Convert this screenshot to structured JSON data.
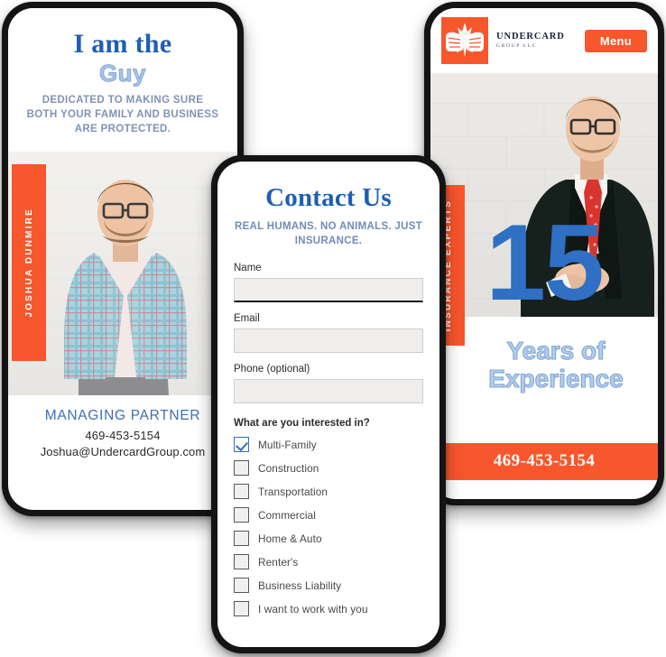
{
  "brand": {
    "accent_orange": "#f8562c",
    "primary_blue": "#1f5fb4",
    "light_blue": "#a7c4e8",
    "muted_blue": "#7f93b5",
    "company_name_line1": "UNDERCARD",
    "company_name_line2": "GROUP LLC",
    "logo_icon": "fist-bump-logo-icon"
  },
  "left_phone": {
    "headline": "I am the",
    "headline_accent": "Guy",
    "subheadline": "DEDICATED TO MAKING SURE BOTH YOUR FAMILY AND BUSINESS ARE PROTECTED.",
    "vertical_tab": "JOSHUA DUNMIRE",
    "photo_alt": "man-in-light-blue-plaid-blazer-photo",
    "role": "MANAGING PARTNER",
    "phone": "469-453-5154",
    "email": "Joshua@UndercardGroup.com"
  },
  "center_phone": {
    "title": "Contact Us",
    "subtitle": "REAL HUMANS. NO ANIMALS. JUST INSURANCE.",
    "fields": [
      {
        "label": "Name",
        "value": "",
        "placeholder": "",
        "focused": true
      },
      {
        "label": "Email",
        "value": "",
        "placeholder": "",
        "focused": false
      },
      {
        "label": "Phone (optional)",
        "value": "",
        "placeholder": "",
        "focused": false
      }
    ],
    "question": "What are you interested in?",
    "options": [
      {
        "label": "Multi-Family",
        "checked": true
      },
      {
        "label": "Construction",
        "checked": false
      },
      {
        "label": "Transportation",
        "checked": false
      },
      {
        "label": "Commercial",
        "checked": false
      },
      {
        "label": "Home & Auto",
        "checked": false
      },
      {
        "label": "Renter's",
        "checked": false
      },
      {
        "label": "Business Liability",
        "checked": false
      },
      {
        "label": "I want to work with you",
        "checked": false
      }
    ]
  },
  "right_phone": {
    "menu_label": "Menu",
    "photo_alt": "man-in-dark-suit-red-tie-white-brick-wall-photo",
    "vertical_tab": "INSURANCE EXPERTS",
    "big_number": "15",
    "years_line1": "Years of",
    "years_line2": "Experience",
    "footer_phone": "469-453-5154"
  }
}
